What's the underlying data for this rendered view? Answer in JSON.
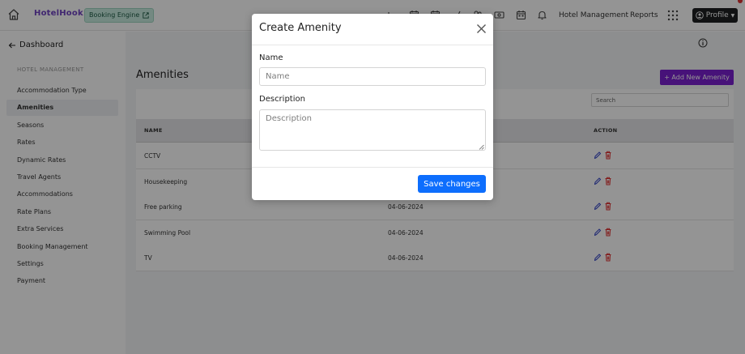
{
  "topbar": {
    "brand": "HotelHook",
    "booking_engine": "Booking Engine",
    "hotel_management": "Hotel Management",
    "reports": "Reports",
    "profile": "Profile"
  },
  "sidebar": {
    "back_label": "Dashboard",
    "heading": "HOTEL MANAGEMENT",
    "items": [
      {
        "label": "Accommodation Type"
      },
      {
        "label": "Amenities"
      },
      {
        "label": "Seasons"
      },
      {
        "label": "Rates"
      },
      {
        "label": "Dynamic Rates"
      },
      {
        "label": "Travel Agents"
      },
      {
        "label": "Accommodations"
      },
      {
        "label": "Rate Plans"
      },
      {
        "label": "Extra Services"
      },
      {
        "label": "Booking Management"
      },
      {
        "label": "Settings"
      },
      {
        "label": "Payment"
      }
    ],
    "active_index": 1
  },
  "main": {
    "title": "Amenities",
    "add_button": "+ Add New Amenity",
    "search_placeholder": "Search",
    "columns": {
      "name": "NAME",
      "action": "ACTION"
    },
    "rows": [
      {
        "name": "CCTV",
        "date": ""
      },
      {
        "name": "Housekeeping",
        "date": ""
      },
      {
        "name": "Free parking",
        "date": "04-06-2024"
      },
      {
        "name": "Swimming Pool",
        "date": "04-06-2024"
      },
      {
        "name": "TV",
        "date": "04-06-2024"
      }
    ]
  },
  "modal": {
    "title": "Create Amenity",
    "name_label": "Name",
    "name_placeholder": "Name",
    "description_label": "Description",
    "description_placeholder": "Description",
    "save_button": "Save changes"
  },
  "colors": {
    "accent_purple": "#7b1fd1",
    "primary_blue": "#0d6efd",
    "delete_red": "#e03131",
    "edit_blue": "#3b4bc8"
  }
}
